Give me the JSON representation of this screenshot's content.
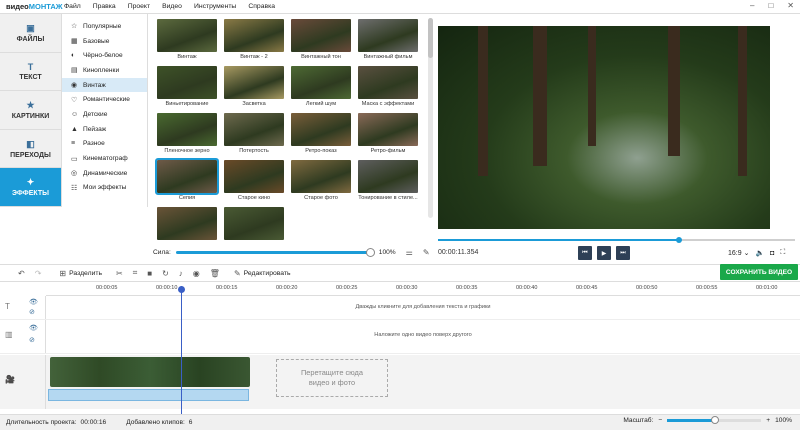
{
  "app": {
    "logo_part1": "видео",
    "logo_part2": "МОНТАЖ",
    "min_glyph": "–",
    "max_glyph": "□",
    "close_glyph": "✕"
  },
  "menu": [
    "Файл",
    "Правка",
    "Проект",
    "Видео",
    "Инструменты",
    "Справка"
  ],
  "leftnav": [
    {
      "label": "ФАЙЛЫ",
      "icon": "files-icon",
      "glyph": "▣"
    },
    {
      "label": "ТЕКСТ",
      "icon": "text-icon",
      "glyph": "T"
    },
    {
      "label": "КАРТИНКИ",
      "icon": "pictures-icon",
      "glyph": "★"
    },
    {
      "label": "ПЕРЕХОДЫ",
      "icon": "transitions-icon",
      "glyph": "◧"
    },
    {
      "label": "ЭФФЕКТЫ",
      "icon": "effects-icon",
      "glyph": "✦"
    }
  ],
  "categories": [
    {
      "label": "Популярные",
      "glyph": "☆"
    },
    {
      "label": "Базовые",
      "glyph": "▦"
    },
    {
      "label": "Чёрно-белое",
      "glyph": "◐"
    },
    {
      "label": "Кинопленки",
      "glyph": "▤"
    },
    {
      "label": "Винтаж",
      "glyph": "◉"
    },
    {
      "label": "Романтические",
      "glyph": "♡"
    },
    {
      "label": "Детские",
      "glyph": "☺"
    },
    {
      "label": "Пейзаж",
      "glyph": "▲"
    },
    {
      "label": "Разное",
      "glyph": "≡"
    },
    {
      "label": "Кинематограф",
      "glyph": "▭"
    },
    {
      "label": "Динамические",
      "glyph": "◎"
    },
    {
      "label": "Мои эффекты",
      "glyph": "☷"
    }
  ],
  "selected_category_index": 4,
  "effects": [
    {
      "label": "Винтаж",
      "tone": "#5c6a3e"
    },
    {
      "label": "Винтаж - 2",
      "tone": "#8a7a46"
    },
    {
      "label": "Винтажный тон",
      "tone": "#6a4a3a"
    },
    {
      "label": "Винтажный фильм",
      "tone": "#6e6e6e"
    },
    {
      "label": "Виньетирование",
      "tone": "#3e5228"
    },
    {
      "label": "Засветка",
      "tone": "#a89a62"
    },
    {
      "label": "Легкий шум",
      "tone": "#4e6a34"
    },
    {
      "label": "Маска с эффектами",
      "tone": "#5a5040"
    },
    {
      "label": "Пленочное зерно",
      "tone": "#4a6a30"
    },
    {
      "label": "Потертость",
      "tone": "#6e6a4e"
    },
    {
      "label": "Ретро-показ",
      "tone": "#7a5e3a"
    },
    {
      "label": "Ретро-фильм",
      "tone": "#8a6a58"
    },
    {
      "label": "Сепия",
      "tone": "#6e5a48"
    },
    {
      "label": "Старое кино",
      "tone": "#6a4a28"
    },
    {
      "label": "Старое фото",
      "tone": "#806a40"
    },
    {
      "label": "Тонирование в стиле...",
      "tone": "#5e5e5e"
    },
    {
      "label": "",
      "tone": "#6a5438"
    },
    {
      "label": "",
      "tone": "#4a5a34"
    }
  ],
  "strength": {
    "label": "Сила:",
    "value": "100%",
    "fraction": 1.0
  },
  "preview": {
    "timecode": "00:00:11.354",
    "aspect": "16:9 ⌄",
    "progress": 0.675
  },
  "toolbar": {
    "split_label": "Разделить",
    "edit_label": "Редактировать",
    "save_label": "СОХРАНИТЬ ВИДЕО"
  },
  "ruler_ticks": [
    "00:00:05",
    "00:00:10",
    "00:00:15",
    "00:00:20",
    "00:00:25",
    "00:00:30",
    "00:00:35",
    "00:00:40",
    "00:00:45",
    "00:00:50",
    "00:00:55",
    "00:01:00"
  ],
  "timeline": {
    "text_hint": "Дважды кликните для добавления текста и графики",
    "overlay_hint": "Наложите одно видео поверх другого",
    "drop_line1": "Перетащите сюда",
    "drop_line2": "видео и фото"
  },
  "status": {
    "duration_label": "Длительность проекта:",
    "duration_value": "00:00:16",
    "clips_label": "Добавлено клипов:",
    "clips_value": "6",
    "zoom_label": "Масштаб:",
    "zoom_value": "100%",
    "zoom_fraction": 0.5
  }
}
